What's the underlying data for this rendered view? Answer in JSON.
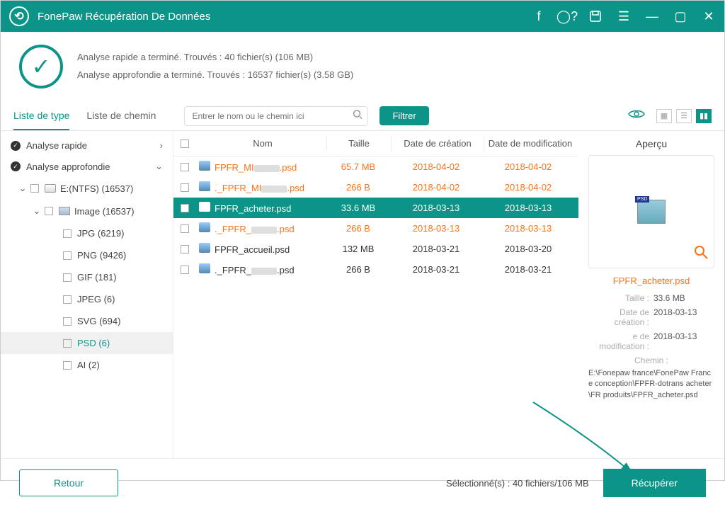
{
  "app": {
    "title": "FonePaw Récupération De Données"
  },
  "status": {
    "line1": "Analyse rapide a terminé. Trouvés : 40 fichier(s) (106 MB)",
    "line2": "Analyse approfondie a terminé. Trouvés : 16537 fichier(s) (3.58 GB)"
  },
  "tabs": {
    "type": "Liste de type",
    "path": "Liste de chemin"
  },
  "search": {
    "placeholder": "Entrer le nom ou le chemin ici"
  },
  "filter_btn": "Filtrer",
  "sidebar": {
    "quick": "Analyse rapide",
    "deep": "Analyse approfondie",
    "drive": "E:(NTFS) (16537)",
    "image": "Image (16537)",
    "types": [
      {
        "label": "JPG (6219)"
      },
      {
        "label": "PNG (9426)"
      },
      {
        "label": "GIF (181)"
      },
      {
        "label": "JPEG (6)"
      },
      {
        "label": "SVG (694)"
      },
      {
        "label": "PSD (6)",
        "selected": true
      },
      {
        "label": "AI (2)"
      }
    ]
  },
  "table": {
    "headers": {
      "name": "Nom",
      "size": "Taille",
      "created": "Date de création",
      "modified": "Date de modification"
    },
    "rows": [
      {
        "pre": "FPFR_MI",
        "blur": true,
        "post": ".psd",
        "size": "65.7 MB",
        "created": "2018-04-02",
        "modified": "2018-04-02",
        "deleted": true
      },
      {
        "pre": "._FPFR_MI",
        "blur": true,
        "post": ".psd",
        "size": "266  B",
        "created": "2018-04-02",
        "modified": "2018-04-02",
        "deleted": true
      },
      {
        "pre": "FPFR_acheter.psd",
        "blur": false,
        "post": "",
        "size": "33.6 MB",
        "created": "2018-03-13",
        "modified": "2018-03-13",
        "deleted": true,
        "selected": true
      },
      {
        "pre": "._FPFR_",
        "blur": true,
        "post": ".psd",
        "size": "266  B",
        "created": "2018-03-13",
        "modified": "2018-03-13",
        "deleted": true
      },
      {
        "pre": "FPFR_accueil.psd",
        "blur": false,
        "post": "",
        "size": "132 MB",
        "created": "2018-03-21",
        "modified": "2018-03-20",
        "deleted": false
      },
      {
        "pre": "._FPFR_",
        "blur": true,
        "post": ".psd",
        "size": "266  B",
        "created": "2018-03-21",
        "modified": "2018-03-21",
        "deleted": false
      }
    ]
  },
  "preview": {
    "title": "Aperçu",
    "filename": "FPFR_acheter.psd",
    "size_label": "Taille :",
    "size": "33.6 MB",
    "created_label": "Date de création :",
    "created": "2018-03-13",
    "modified_label": "e de modification :",
    "modified": "2018-03-13",
    "path_label": "Chemin :",
    "path": "E:\\Fonepaw france\\FonePaw France conception\\FPFR-dotrans acheter\\FR produits\\FPFR_acheter.psd"
  },
  "footer": {
    "back": "Retour",
    "selected": "Sélectionné(s) : 40 fichiers/106 MB",
    "recover": "Récupérer"
  }
}
